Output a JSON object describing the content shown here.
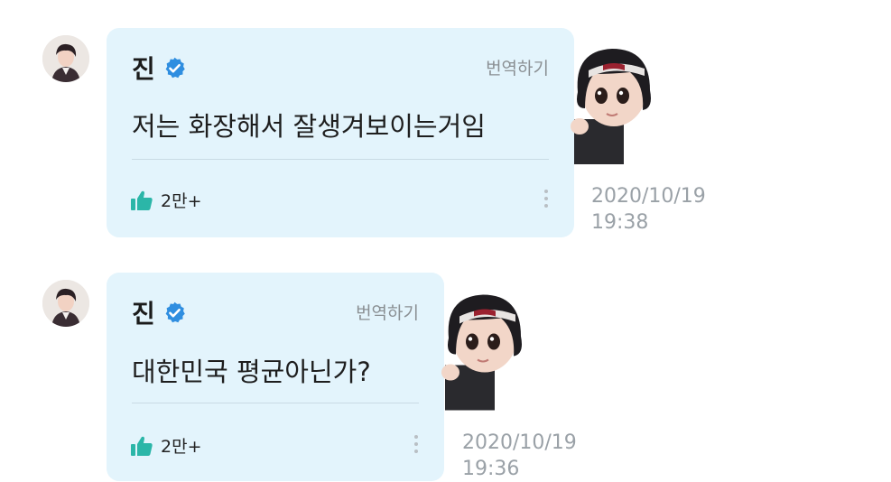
{
  "comments": [
    {
      "author": "진",
      "translate_label": "번역하기",
      "text": "저는 화장해서 잘생겨보이는거임",
      "likes": "2만+",
      "date": "2020/10/19",
      "time": "19:38"
    },
    {
      "author": "진",
      "translate_label": "번역하기",
      "text": "대한민국 평균아닌가?",
      "likes": "2만+",
      "date": "2020/10/19",
      "time": "19:36"
    }
  ],
  "colors": {
    "bubble": "#e3f4fc",
    "verified": "#2f8ee0",
    "like": "#2bb6a8",
    "muted": "#9aa1a7"
  },
  "icons": [
    "verified-badge-icon",
    "thumbs-up-icon",
    "more-vertical-icon"
  ]
}
